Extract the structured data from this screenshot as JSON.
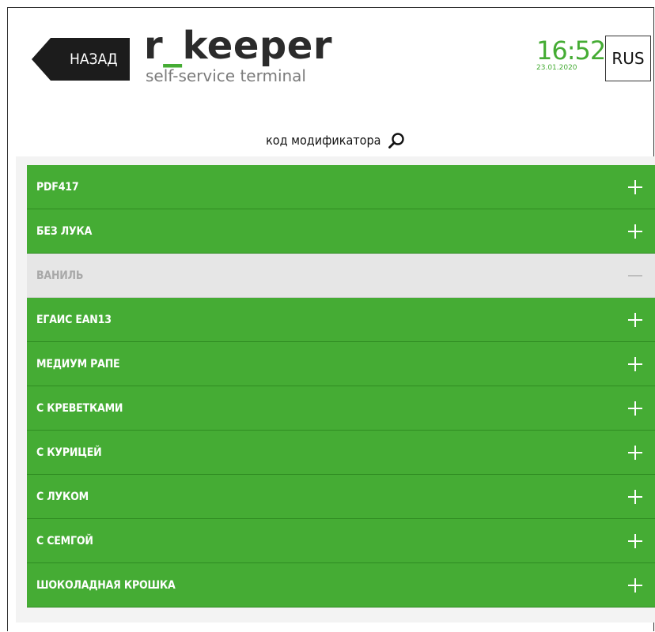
{
  "header": {
    "back_label": "НАЗАД",
    "logo_title_left": "r",
    "logo_title_underscore": "_",
    "logo_title_right": "keeper",
    "logo_subtitle": "self-service terminal",
    "time": "16:52",
    "date": "23.01.2020",
    "language": "RUS"
  },
  "search": {
    "label": "код модификатора",
    "icon": "search-icon"
  },
  "modifiers": [
    {
      "label": "PDF417",
      "state": "available",
      "action_icon": "plus-icon"
    },
    {
      "label": "БЕЗ ЛУКА",
      "state": "available",
      "action_icon": "plus-icon"
    },
    {
      "label": "ВАНИЛЬ",
      "state": "disabled",
      "action_icon": "minus-icon"
    },
    {
      "label": "ЕГАИС EAN13",
      "state": "available",
      "action_icon": "plus-icon"
    },
    {
      "label": "МЕДИУМ РАПЕ",
      "state": "available",
      "action_icon": "plus-icon"
    },
    {
      "label": "С КРЕВЕТКАМИ",
      "state": "available",
      "action_icon": "plus-icon"
    },
    {
      "label": "С КУРИЦЕЙ",
      "state": "available",
      "action_icon": "plus-icon"
    },
    {
      "label": "С ЛУКОМ",
      "state": "available",
      "action_icon": "plus-icon"
    },
    {
      "label": "С СЕМГОЙ",
      "state": "available",
      "action_icon": "plus-icon"
    },
    {
      "label": "ШОКОЛАДНАЯ КРОШКА",
      "state": "available",
      "action_icon": "plus-icon"
    }
  ],
  "colors": {
    "accent_green": "#45ac34",
    "disabled_row": "#e6e6e6",
    "back_button": "#1c1c1c",
    "panel_background": "#f3f3f3"
  }
}
